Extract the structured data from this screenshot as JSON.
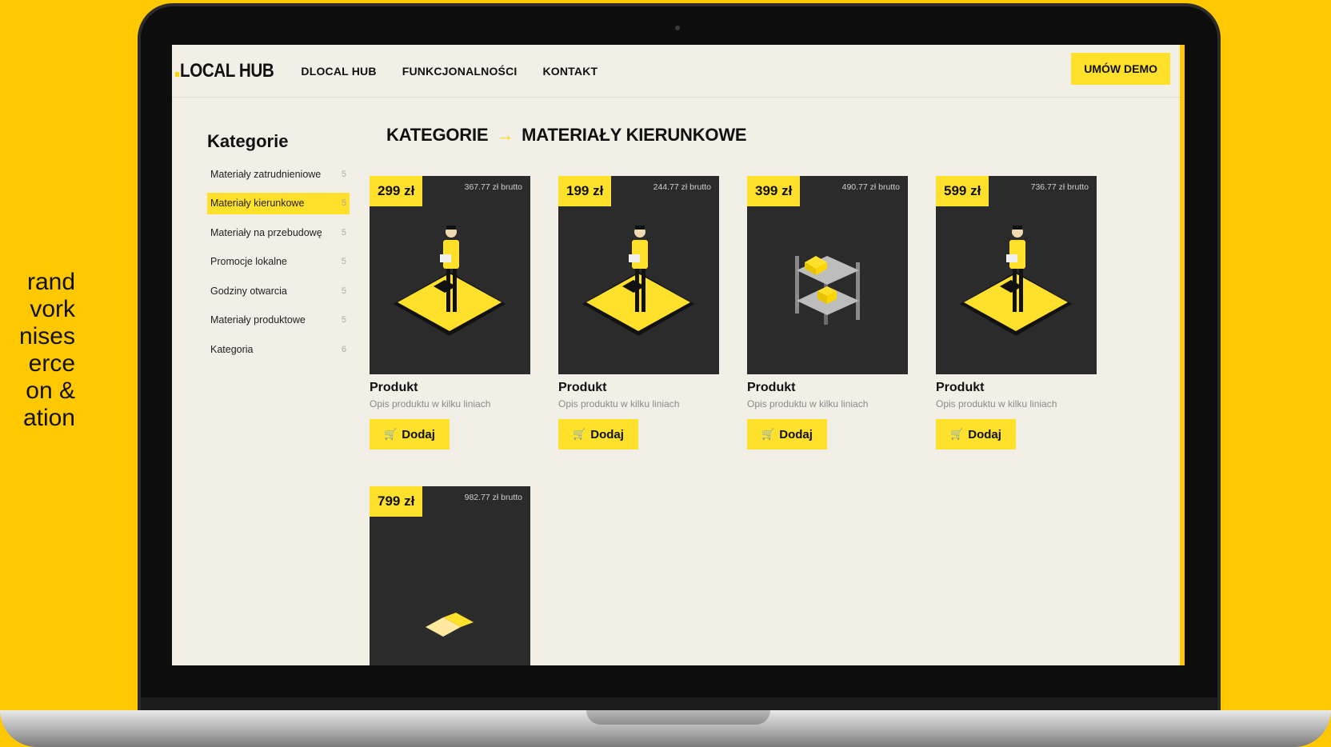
{
  "side_text": [
    "rand",
    "vork",
    "nises",
    "erce",
    "on &",
    "ation"
  ],
  "header": {
    "logo": "LOCAL HUB",
    "nav": [
      "DLOCAL HUB",
      "FUNKCJONALNOŚCI",
      "KONTAKT"
    ],
    "demo_label": "UMÓW DEMO"
  },
  "sidebar": {
    "title": "Kategorie",
    "items": [
      {
        "label": "Materiały zatrudnieniowe",
        "count": "5"
      },
      {
        "label": "Materiały kierunkowe",
        "count": "5",
        "active": true
      },
      {
        "label": "Materiały na przebudowę",
        "count": "5"
      },
      {
        "label": "Promocje lokalne",
        "count": "5"
      },
      {
        "label": "Godziny otwarcia",
        "count": "5"
      },
      {
        "label": "Materiały produktowe",
        "count": "5"
      },
      {
        "label": "Kategoria",
        "count": "6"
      }
    ]
  },
  "breadcrumb": {
    "root": "KATEGORIE",
    "arrow": "→",
    "current": "MATERIAŁY KIERUNKOWE"
  },
  "products": [
    {
      "price": "299 zł",
      "brutto": "367.77 zł brutto",
      "name": "Produkt",
      "desc": "Opis produktu w kilku liniach",
      "add": "Dodaj",
      "illustration": "person-on-platform"
    },
    {
      "price": "199 zł",
      "brutto": "244.77 zł brutto",
      "name": "Produkt",
      "desc": "Opis produktu w kilku liniach",
      "add": "Dodaj",
      "illustration": "person-on-platform"
    },
    {
      "price": "399 zł",
      "brutto": "490.77 zł brutto",
      "name": "Produkt",
      "desc": "Opis produktu w kilku liniach",
      "add": "Dodaj",
      "illustration": "shelf-with-boxes"
    },
    {
      "price": "599 zł",
      "brutto": "736.77 zł brutto",
      "name": "Produkt",
      "desc": "Opis produktu w kilku liniach",
      "add": "Dodaj",
      "illustration": "person-on-platform"
    },
    {
      "price": "799 zł",
      "brutto": "982.77 zł brutto",
      "illustration": "box-partial"
    }
  ],
  "icons": {
    "cart": "shopping-cart-icon"
  },
  "colors": {
    "background": "#FFC800",
    "accent": "#FFE02B",
    "screen": "#F2F0E6",
    "card": "#2B2B2B"
  }
}
